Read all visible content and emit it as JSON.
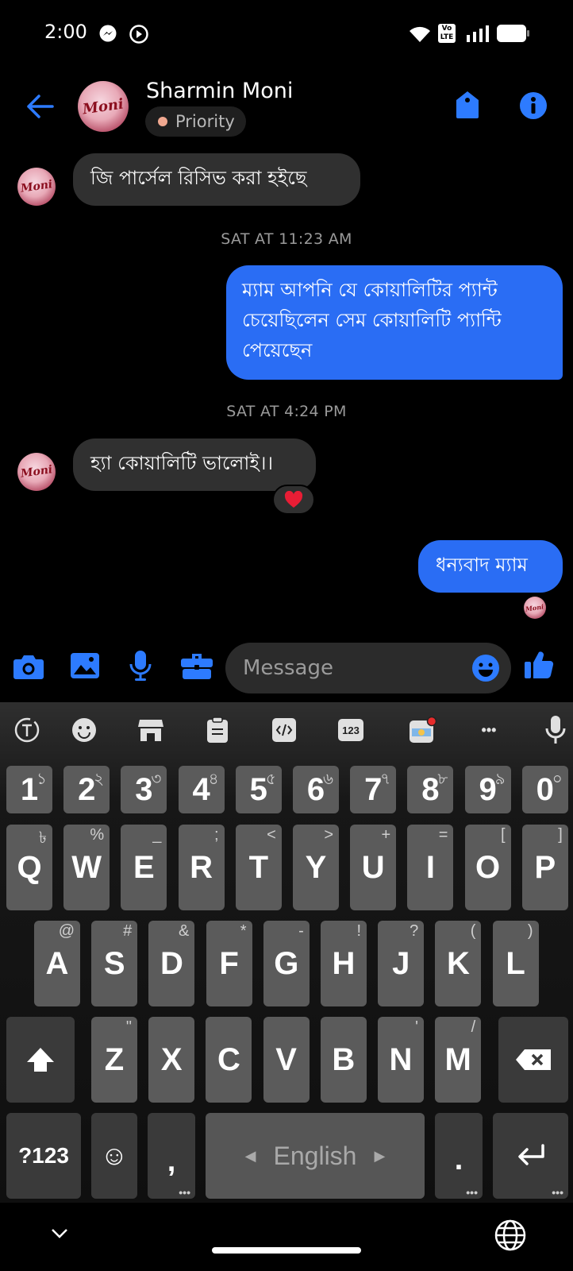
{
  "status_bar": {
    "time": "2:00",
    "volte": "Vo LTE"
  },
  "header": {
    "contact_name": "Sharmin Moni",
    "priority_label": "Priority",
    "avatar_text": "Moni"
  },
  "messages": [
    {
      "id": "m1",
      "direction": "in",
      "text": "জি পার্সেল রিসিভ করা হইছে"
    },
    {
      "id": "t1",
      "timestamp": "SAT AT 11:23 AM"
    },
    {
      "id": "m2",
      "direction": "out",
      "lines": [
        "ম্যাম আপনি যে কোয়ালিটির প্যান্ট",
        "চেয়েছিলেন সেম কোয়ালিটি প্যান্টি",
        "পেয়েছেন"
      ]
    },
    {
      "id": "t2",
      "timestamp": "SAT AT 4:24 PM"
    },
    {
      "id": "m3",
      "direction": "in",
      "text": "হ্যা কোয়ালিটি ভালোই।।",
      "reaction": "❤️"
    },
    {
      "id": "m4",
      "direction": "out",
      "text": "ধন্যবাদ ম্যাম"
    }
  ],
  "composer": {
    "placeholder": "Message"
  },
  "keyboard": {
    "toolbar_icons": [
      "translate-icon",
      "emoji-icon",
      "store-icon",
      "clipboard-icon",
      "code-icon",
      "numbers-icon",
      "theme-icon",
      "more-icon",
      "mic-icon"
    ],
    "toolbar_123": "123",
    "toolbar_more": "•••",
    "row_numbers": [
      {
        "k": "1",
        "h": "১"
      },
      {
        "k": "2",
        "h": "২"
      },
      {
        "k": "3",
        "h": "৩"
      },
      {
        "k": "4",
        "h": "৪"
      },
      {
        "k": "5",
        "h": "৫"
      },
      {
        "k": "6",
        "h": "৬"
      },
      {
        "k": "7",
        "h": "৭"
      },
      {
        "k": "8",
        "h": "৮"
      },
      {
        "k": "9",
        "h": "৯"
      },
      {
        "k": "0",
        "h": "০"
      }
    ],
    "row_top": [
      {
        "k": "Q",
        "h": "৳"
      },
      {
        "k": "W",
        "h": "%"
      },
      {
        "k": "E",
        "h": "_"
      },
      {
        "k": "R",
        "h": ";"
      },
      {
        "k": "T",
        "h": "<"
      },
      {
        "k": "Y",
        "h": ">"
      },
      {
        "k": "U",
        "h": "+"
      },
      {
        "k": "I",
        "h": "="
      },
      {
        "k": "O",
        "h": "["
      },
      {
        "k": "P",
        "h": "]"
      }
    ],
    "row_home": [
      {
        "k": "A",
        "h": "@"
      },
      {
        "k": "S",
        "h": "#"
      },
      {
        "k": "D",
        "h": "&"
      },
      {
        "k": "F",
        "h": "*"
      },
      {
        "k": "G",
        "h": "-"
      },
      {
        "k": "H",
        "h": "!"
      },
      {
        "k": "J",
        "h": "?"
      },
      {
        "k": "K",
        "h": "("
      },
      {
        "k": "L",
        "h": ")"
      }
    ],
    "row_bottom": [
      {
        "k": "Z",
        "h": "\""
      },
      {
        "k": "X",
        "h": ""
      },
      {
        "k": "C",
        "h": ""
      },
      {
        "k": "V",
        "h": ""
      },
      {
        "k": "B",
        "h": ""
      },
      {
        "k": "N",
        "h": "'"
      },
      {
        "k": "M",
        "h": "/"
      }
    ],
    "symbols_key": "?123",
    "comma_key": ",",
    "space_label": "English",
    "period_key": ".",
    "emoji_key": "☺"
  }
}
